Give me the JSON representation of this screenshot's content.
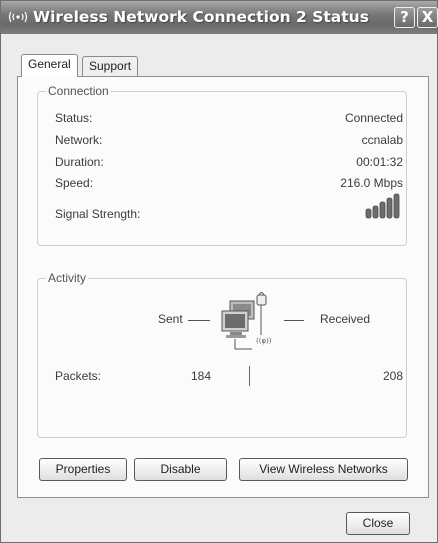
{
  "window": {
    "title": "Wireless Network Connection 2 Status",
    "help_label": "?",
    "close_label": "X"
  },
  "tabs": [
    {
      "label": "General",
      "active": true
    },
    {
      "label": "Support",
      "active": false
    }
  ],
  "connection": {
    "group_label": "Connection",
    "rows": [
      {
        "label": "Status:",
        "value": "Connected"
      },
      {
        "label": "Network:",
        "value": "ccnalab"
      },
      {
        "label": "Duration:",
        "value": "00:01:32"
      },
      {
        "label": "Speed:",
        "value": "216.0 Mbps"
      }
    ],
    "signal_label": "Signal Strength:",
    "signal_bars_total": 5,
    "signal_bars_lit": 5
  },
  "activity": {
    "group_label": "Activity",
    "sent_label": "Sent",
    "received_label": "Received",
    "packets_label": "Packets:",
    "packets_sent": "184",
    "packets_received": "208"
  },
  "buttons": {
    "properties": "Properties",
    "disable": "Disable",
    "view_networks": "View Wireless Networks",
    "close": "Close"
  },
  "icons": {
    "title": "wireless-signal-icon",
    "activity": "network-computers-icon",
    "signal": "signal-strength-icon"
  }
}
